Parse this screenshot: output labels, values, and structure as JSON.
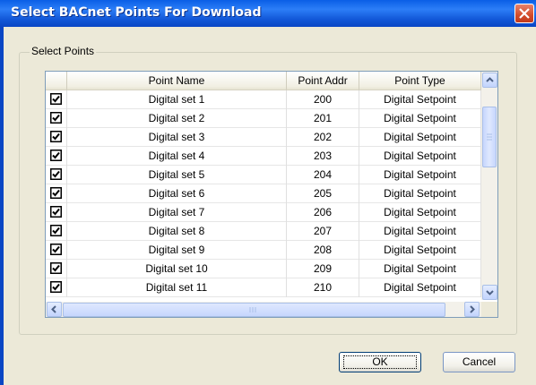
{
  "window": {
    "title": "Select BACnet Points For Download"
  },
  "group": {
    "label": "Select Points"
  },
  "table": {
    "columns": [
      "",
      "Point Name",
      "Point Addr",
      "Point Type"
    ],
    "rows": [
      {
        "checked": true,
        "name": "Digital set 1",
        "addr": "200",
        "type": "Digital Setpoint"
      },
      {
        "checked": true,
        "name": "Digital set 2",
        "addr": "201",
        "type": "Digital Setpoint"
      },
      {
        "checked": true,
        "name": "Digital set 3",
        "addr": "202",
        "type": "Digital Setpoint"
      },
      {
        "checked": true,
        "name": "Digital set 4",
        "addr": "203",
        "type": "Digital Setpoint"
      },
      {
        "checked": true,
        "name": "Digital set 5",
        "addr": "204",
        "type": "Digital Setpoint"
      },
      {
        "checked": true,
        "name": "Digital set 6",
        "addr": "205",
        "type": "Digital Setpoint"
      },
      {
        "checked": true,
        "name": "Digital set 7",
        "addr": "206",
        "type": "Digital Setpoint"
      },
      {
        "checked": true,
        "name": "Digital set 8",
        "addr": "207",
        "type": "Digital Setpoint"
      },
      {
        "checked": true,
        "name": "Digital set 9",
        "addr": "208",
        "type": "Digital Setpoint"
      },
      {
        "checked": true,
        "name": "Digital set 10",
        "addr": "209",
        "type": "Digital Setpoint"
      },
      {
        "checked": true,
        "name": "Digital set 11",
        "addr": "210",
        "type": "Digital Setpoint"
      }
    ]
  },
  "buttons": {
    "ok_label": "OK",
    "cancel_label": "Cancel"
  },
  "icons": {
    "close": "close-icon",
    "checkbox": "checkbox-checked-icon",
    "scroll_up": "arrow-up-icon",
    "scroll_down": "arrow-down-icon",
    "scroll_left": "arrow-left-icon",
    "scroll_right": "arrow-right-icon"
  },
  "colors": {
    "titlebar": "#0a5fe6",
    "dialog_bg": "#ece9d8",
    "close_button": "#d24c2a"
  }
}
